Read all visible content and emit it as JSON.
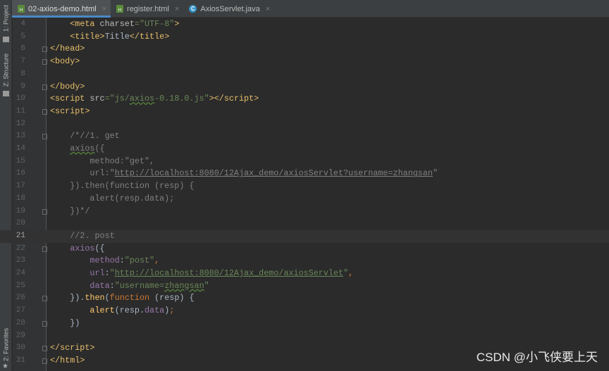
{
  "sidebar": {
    "project": "1: Project",
    "structure": "Z: Structure",
    "favorites": "2: Favorites"
  },
  "tabs": [
    {
      "label": "02-axios-demo.html",
      "icon": "html-file-icon",
      "active": true
    },
    {
      "label": "register.html",
      "icon": "html-file-icon",
      "active": false
    },
    {
      "label": "AxiosServlet.java",
      "icon": "java-class-icon",
      "active": false
    }
  ],
  "current_line": 21,
  "lines": [
    {
      "n": 4,
      "t": [
        [
          "",
          "    "
        ],
        [
          "tag",
          "<meta "
        ],
        [
          "attr",
          "charset"
        ],
        [
          "str",
          "=\"UTF-8\""
        ],
        [
          "tag",
          ">"
        ]
      ]
    },
    {
      "n": 5,
      "t": [
        [
          "",
          "    "
        ],
        [
          "tag",
          "<title>"
        ],
        [
          "",
          "Title"
        ],
        [
          "tag",
          "</title>"
        ]
      ]
    },
    {
      "n": 6,
      "f": 1,
      "t": [
        [
          "tag",
          "</head>"
        ]
      ]
    },
    {
      "n": 7,
      "f": 1,
      "t": [
        [
          "tag",
          "<body>"
        ]
      ]
    },
    {
      "n": 8,
      "t": []
    },
    {
      "n": 9,
      "f": 1,
      "t": [
        [
          "tag",
          "</body>"
        ]
      ]
    },
    {
      "n": 10,
      "t": [
        [
          "tag",
          "<script "
        ],
        [
          "attr",
          "src"
        ],
        [
          "str",
          "=\"js/"
        ],
        [
          "str wavy",
          "axios"
        ],
        [
          "str",
          "-0.18.0.js\""
        ],
        [
          "tag",
          "></script>"
        ]
      ]
    },
    {
      "n": 11,
      "f": 1,
      "t": [
        [
          "tag",
          "<script>"
        ]
      ]
    },
    {
      "n": 12,
      "t": []
    },
    {
      "n": 13,
      "f": 1,
      "t": [
        [
          "cm",
          "    /*//1. get"
        ]
      ]
    },
    {
      "n": 14,
      "t": [
        [
          "cm",
          "    "
        ],
        [
          "cm wavy",
          "axios"
        ],
        [
          "cm",
          "({"
        ]
      ]
    },
    {
      "n": 15,
      "t": [
        [
          "cm",
          "        method:\"get\","
        ]
      ]
    },
    {
      "n": 16,
      "t": [
        [
          "cm",
          "        url:\""
        ],
        [
          "cm url",
          "http://localhost:8080/12Ajax_demo/axiosServlet?username=zhangsan"
        ],
        [
          "cm",
          "\""
        ]
      ]
    },
    {
      "n": 17,
      "t": [
        [
          "cm",
          "    }).then(function (resp) {"
        ]
      ]
    },
    {
      "n": 18,
      "t": [
        [
          "cm",
          "        alert(resp.data);"
        ]
      ]
    },
    {
      "n": 19,
      "f": 1,
      "t": [
        [
          "cm",
          "    })*/"
        ]
      ]
    },
    {
      "n": 20,
      "t": []
    },
    {
      "n": 21,
      "t": [
        [
          "cm",
          "    //2. post"
        ]
      ]
    },
    {
      "n": 22,
      "f": 1,
      "t": [
        [
          "",
          "    "
        ],
        [
          "prop",
          "axios"
        ],
        [
          "",
          "({"
        ]
      ]
    },
    {
      "n": 23,
      "t": [
        [
          "",
          "        "
        ],
        [
          "prop",
          "method"
        ],
        [
          "",
          ":"
        ],
        [
          "str",
          "\"post\""
        ],
        [
          "kw",
          ","
        ]
      ]
    },
    {
      "n": 24,
      "t": [
        [
          "",
          "        "
        ],
        [
          "prop",
          "url"
        ],
        [
          "",
          ":"
        ],
        [
          "str",
          "\""
        ],
        [
          "str url",
          "http://localhost:8080/12Ajax_demo/axiosServlet"
        ],
        [
          "str",
          "\""
        ],
        [
          "kw",
          ","
        ]
      ]
    },
    {
      "n": 25,
      "t": [
        [
          "",
          "        "
        ],
        [
          "prop",
          "data"
        ],
        [
          "",
          ":"
        ],
        [
          "str",
          "\"username="
        ],
        [
          "str wavy",
          "zhangsan"
        ],
        [
          "str",
          "\""
        ]
      ]
    },
    {
      "n": 26,
      "f": 1,
      "t": [
        [
          "",
          "    })."
        ],
        [
          "fn",
          "then"
        ],
        [
          "",
          "("
        ],
        [
          "kw",
          "function "
        ],
        [
          "",
          "(resp) {"
        ]
      ]
    },
    {
      "n": 27,
      "t": [
        [
          "",
          "        "
        ],
        [
          "fn",
          "alert"
        ],
        [
          "",
          "(resp."
        ],
        [
          "prop",
          "data"
        ],
        [
          "",
          ")"
        ],
        [
          "kw",
          ";"
        ]
      ]
    },
    {
      "n": 28,
      "f": 1,
      "t": [
        [
          "",
          "    })"
        ]
      ]
    },
    {
      "n": 29,
      "t": []
    },
    {
      "n": 30,
      "f": 1,
      "t": [
        [
          "tag",
          "</script>"
        ]
      ]
    },
    {
      "n": 31,
      "f": 1,
      "t": [
        [
          "tag",
          "</html>"
        ]
      ]
    }
  ],
  "watermark": "CSDN @小飞侠要上天"
}
